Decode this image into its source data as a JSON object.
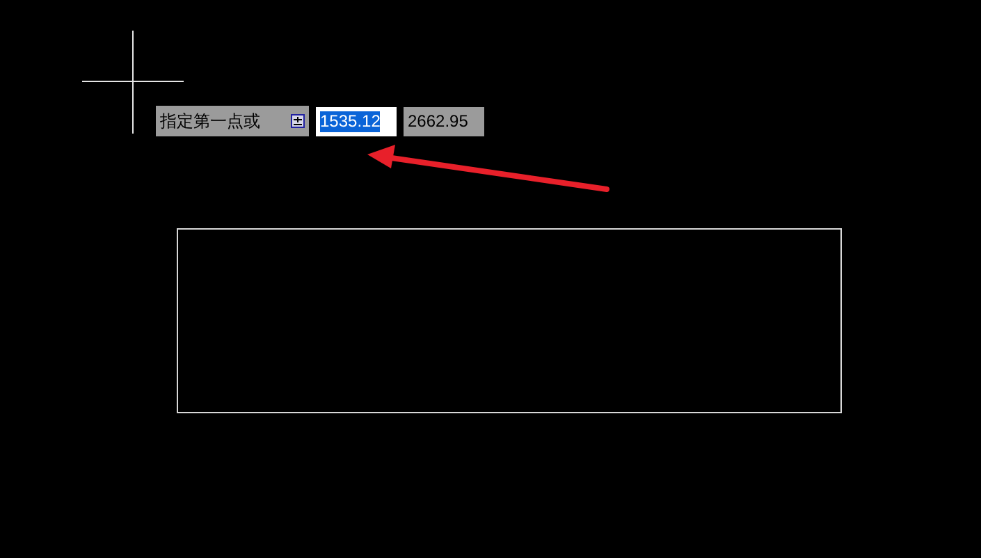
{
  "dynamic_input": {
    "prompt": "指定第一点或",
    "fields": [
      {
        "value": "1535.12",
        "focused": true
      },
      {
        "value": "2662.95",
        "focused": false
      }
    ]
  }
}
